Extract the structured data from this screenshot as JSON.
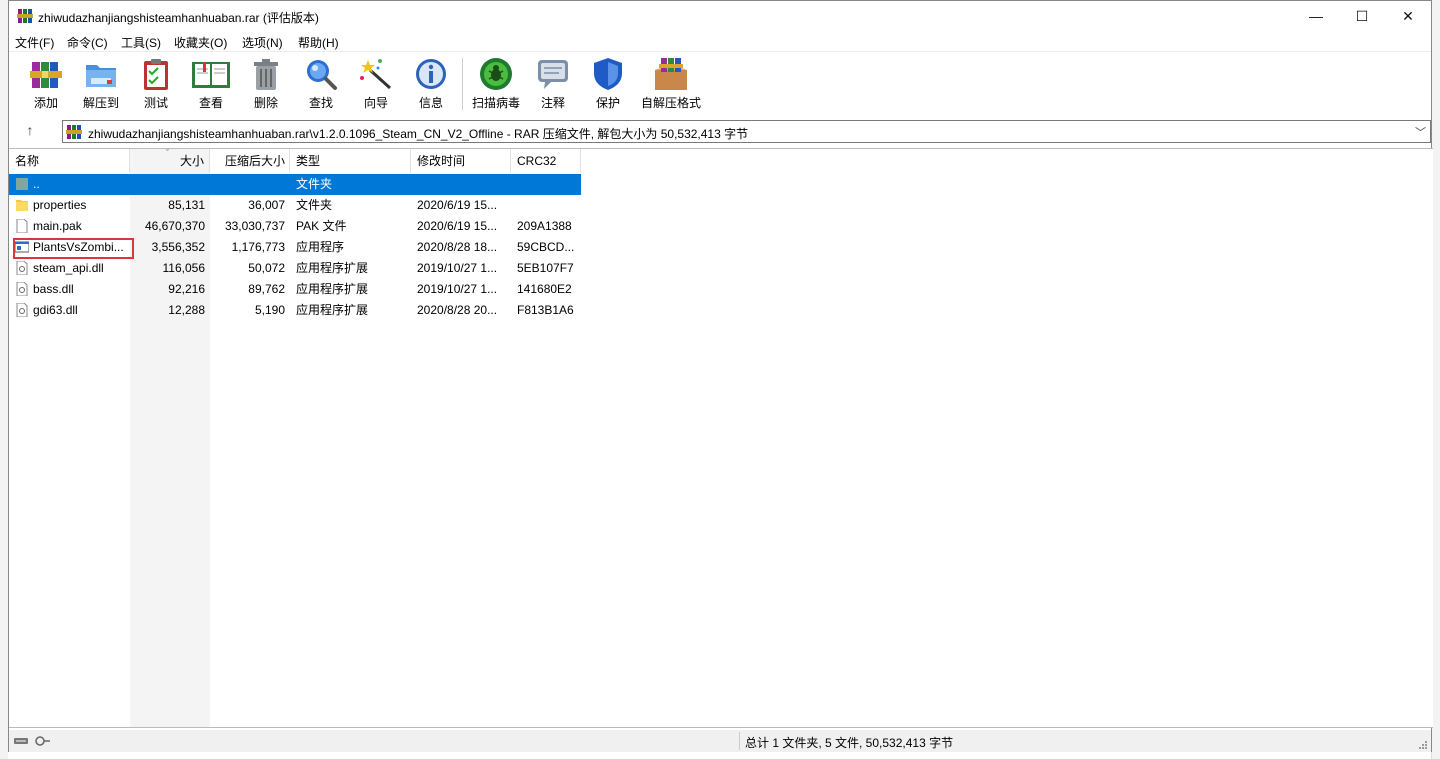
{
  "window": {
    "title": "zhiwudazhanjiangshisteamhanhuaban.rar (评估版本)",
    "minimize": "—",
    "maximize": "☐",
    "close": "✕"
  },
  "menu": [
    "文件(F)",
    "命令(C)",
    "工具(S)",
    "收藏夹(O)",
    "选项(N)",
    "帮助(H)"
  ],
  "toolbar": [
    {
      "label": "添加",
      "icon": "archive-add-icon"
    },
    {
      "label": "解压到",
      "icon": "extract-folder-icon"
    },
    {
      "label": "测试",
      "icon": "test-clipboard-icon"
    },
    {
      "label": "查看",
      "icon": "view-book-icon"
    },
    {
      "label": "删除",
      "icon": "trash-icon"
    },
    {
      "label": "查找",
      "icon": "magnifier-icon"
    },
    {
      "label": "向导",
      "icon": "wizard-wand-icon"
    },
    {
      "label": "信息",
      "icon": "info-icon"
    },
    {
      "label": "扫描病毒",
      "icon": "virus-scan-icon"
    },
    {
      "label": "注释",
      "icon": "comment-icon"
    },
    {
      "label": "保护",
      "icon": "shield-icon"
    },
    {
      "label": "自解压格式",
      "icon": "sfx-box-icon"
    }
  ],
  "address": {
    "up": "↑",
    "path": "zhiwudazhanjiangshisteamhanhuaban.rar\\v1.2.0.1096_Steam_CN_V2_Offline - RAR 压缩文件, 解包大小为 50,532,413 字节",
    "dropdown": "﹀"
  },
  "columns": {
    "name": "名称",
    "size": "大小",
    "packed": "压缩后大小",
    "type": "类型",
    "modified": "修改时间",
    "crc": "CRC32"
  },
  "files": [
    {
      "name": "..",
      "size": "",
      "packed": "",
      "type": "文件夹",
      "modified": "",
      "crc": "",
      "kind": "parent"
    },
    {
      "name": "properties",
      "size": "85,131",
      "packed": "36,007",
      "type": "文件夹",
      "modified": "2020/6/19 15...",
      "crc": "",
      "kind": "folder"
    },
    {
      "name": "main.pak",
      "size": "46,670,370",
      "packed": "33,030,737",
      "type": "PAK 文件",
      "modified": "2020/6/19 15...",
      "crc": "209A1388",
      "kind": "file"
    },
    {
      "name": "PlantsVsZombi...",
      "size": "3,556,352",
      "packed": "1,176,773",
      "type": "应用程序",
      "modified": "2020/8/28 18...",
      "crc": "59CBCD...",
      "kind": "exe"
    },
    {
      "name": "steam_api.dll",
      "size": "116,056",
      "packed": "50,072",
      "type": "应用程序扩展",
      "modified": "2019/10/27 1...",
      "crc": "5EB107F7",
      "kind": "dll"
    },
    {
      "name": "bass.dll",
      "size": "92,216",
      "packed": "89,762",
      "type": "应用程序扩展",
      "modified": "2019/10/27 1...",
      "crc": "141680E2",
      "kind": "dll"
    },
    {
      "name": "gdi63.dll",
      "size": "12,288",
      "packed": "5,190",
      "type": "应用程序扩展",
      "modified": "2020/8/28 20...",
      "crc": "F813B1A6",
      "kind": "dll"
    }
  ],
  "status": {
    "summary": "总计 1 文件夹, 5 文件, 50,532,413 字节"
  },
  "colors": {
    "selection": "#0078d7",
    "highlight_box": "#d9363e"
  }
}
